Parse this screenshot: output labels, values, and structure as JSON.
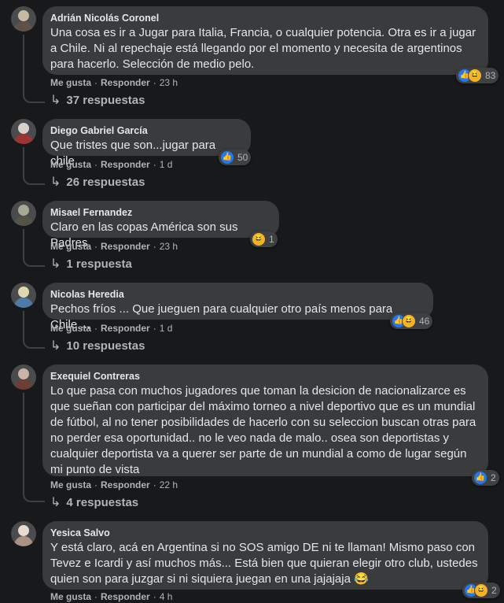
{
  "labels": {
    "like": "Me gusta",
    "reply": "Responder"
  },
  "comments": [
    {
      "author": "Adrián Nicolás Coronel",
      "text": "Una cosa es ir a Jugar para Italia, Francia, o cualquier potencia. Otra es ir a jugar a Chile. Ni al repechaje está llegando por el momento y necesita de argentinos para hacerlo. Selección de medio pelo.",
      "time": "23 h",
      "reactions": [
        "like-icon",
        "haha-icon"
      ],
      "reaction_count": "83",
      "replies": "37 respuestas",
      "avatar_color": "#7a6a58"
    },
    {
      "author": "Diego Gabriel García",
      "text": "Que tristes que son...jugar para chile.",
      "time": "1 d",
      "reactions": [
        "like-icon"
      ],
      "reaction_count": "50",
      "replies": "26 respuestas",
      "avatar_color": "#8a3b3b"
    },
    {
      "author": "Misael Fernandez",
      "text": "Claro en las copas América son sus Padres",
      "time": "23 h",
      "reactions": [
        "haha-icon"
      ],
      "reaction_count": "1",
      "replies": "1 respuesta",
      "avatar_color": "#6d6d5a"
    },
    {
      "author": "Nicolas Heredia",
      "text": "Pechos fríos ... Que jueguen para cualquier otro país menos para Chile....",
      "time": "1 d",
      "reactions": [
        "like-icon",
        "haha-icon"
      ],
      "reaction_count": "46",
      "replies": "10 respuestas",
      "avatar_color": "#5b7fa0"
    },
    {
      "author": "Exequiel Contreras",
      "text": "Lo que pasa con muchos jugadores que toman la desicion de nacionalizarce es que sueñan con participar del máximo torneo a nivel deportivo que es un mundial de fútbol, al no tener posibilidades de hacerlo con su seleccion buscan otras para no perder esa oportunidad.. no le veo nada de malo.. osea son deportistas y cualquier deportista va a querer ser parte de un mundial a como de lugar según mi punto de vista",
      "time": "22 h",
      "reactions": [
        "like-icon"
      ],
      "reaction_count": "2",
      "replies": "4 respuestas",
      "avatar_color": "#8a5a4a"
    },
    {
      "author": "Yesica Salvo",
      "text": "Y está claro, acá en Argentina si no SOS amigo DE ni te llaman! Mismo paso con Tevez e Icardi y así muchos más... Está bien que quieran elegir otro club, ustedes quien son para juzgar si ni siquiera juegan en una jajajaja 😂",
      "time": "4 h",
      "reactions": [
        "like-icon",
        "haha-icon"
      ],
      "reaction_count": "2",
      "replies": "",
      "avatar_color": "#b7a79a"
    }
  ]
}
